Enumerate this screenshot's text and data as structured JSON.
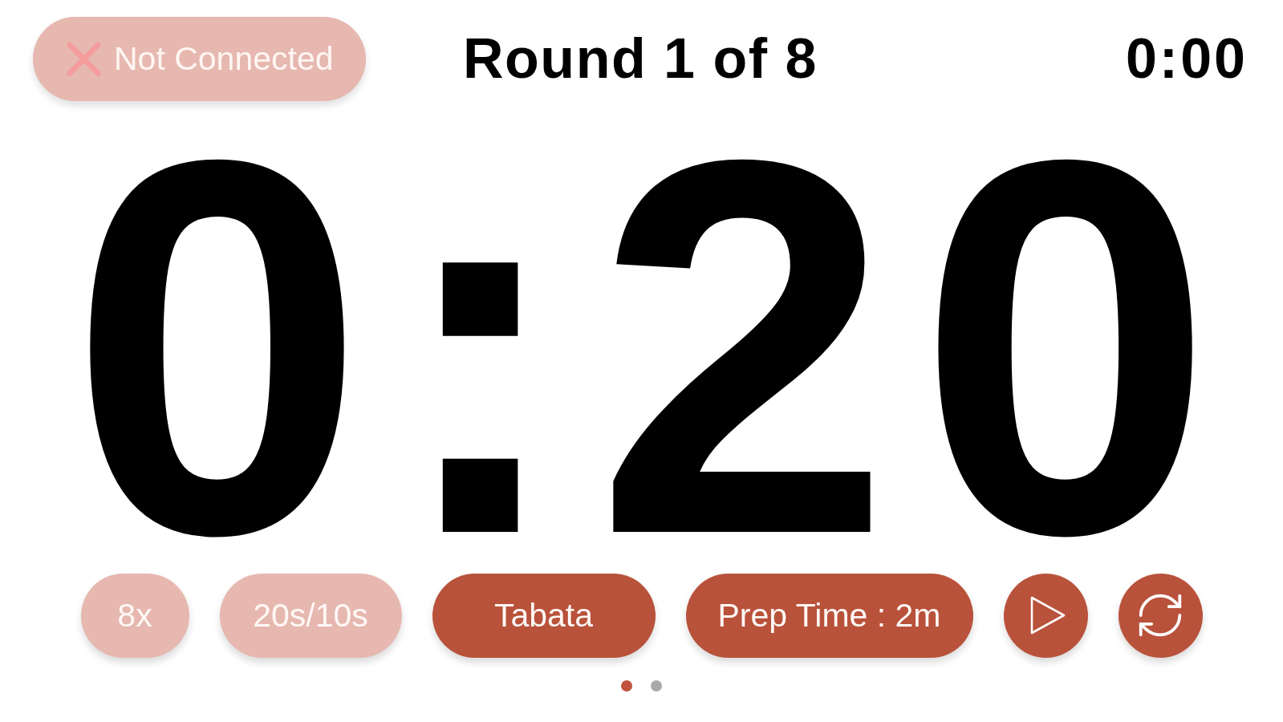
{
  "status": {
    "label": "Not Connected",
    "connected": false
  },
  "header": {
    "round": "Round 1 of 8",
    "elapsed": "0:00"
  },
  "timer": {
    "remaining": "0:20"
  },
  "controls": [
    {
      "kind": "text",
      "label": "8x",
      "disabled": true
    },
    {
      "kind": "text",
      "label": "20s/10s",
      "disabled": true
    },
    {
      "kind": "text",
      "label": "Tabata",
      "disabled": false
    },
    {
      "kind": "text",
      "label": "Prep Time : 2m",
      "disabled": false
    },
    {
      "kind": "play",
      "disabled": false
    },
    {
      "kind": "reset",
      "disabled": false
    }
  ],
  "pages": [
    {
      "selected": true
    },
    {
      "selected": false
    }
  ]
}
